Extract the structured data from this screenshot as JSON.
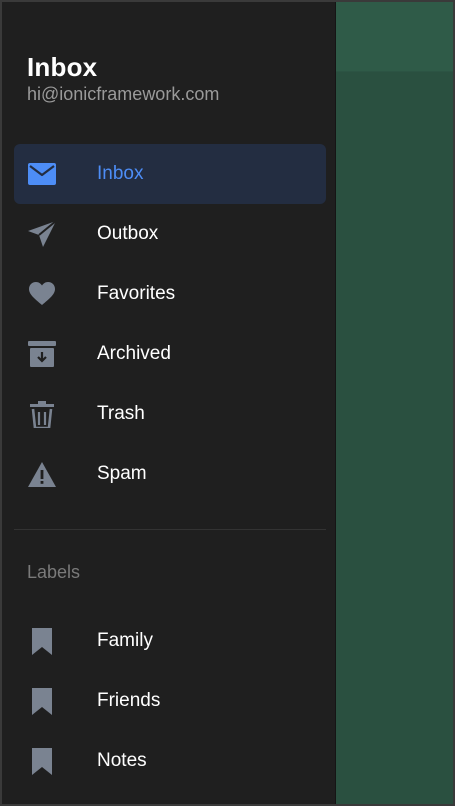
{
  "menu": {
    "title": "Inbox",
    "subtitle": "hi@ionicframework.com",
    "items": [
      {
        "label": "Inbox",
        "icon": "mail-icon",
        "selected": true
      },
      {
        "label": "Outbox",
        "icon": "paper-plane-icon",
        "selected": false
      },
      {
        "label": "Favorites",
        "icon": "heart-icon",
        "selected": false
      },
      {
        "label": "Archived",
        "icon": "archive-icon",
        "selected": false
      },
      {
        "label": "Trash",
        "icon": "trash-icon",
        "selected": false
      },
      {
        "label": "Spam",
        "icon": "warning-icon",
        "selected": false
      }
    ]
  },
  "labels": {
    "heading": "Labels",
    "items": [
      {
        "label": "Family",
        "icon": "bookmark-icon"
      },
      {
        "label": "Friends",
        "icon": "bookmark-icon"
      },
      {
        "label": "Notes",
        "icon": "bookmark-icon"
      }
    ]
  },
  "colors": {
    "menu_background": "#1f1f1f",
    "selected_background": "#232d41",
    "accent": "#4d8df6",
    "icon_gray": "#7a8391",
    "backdrop": "#2a5040"
  }
}
